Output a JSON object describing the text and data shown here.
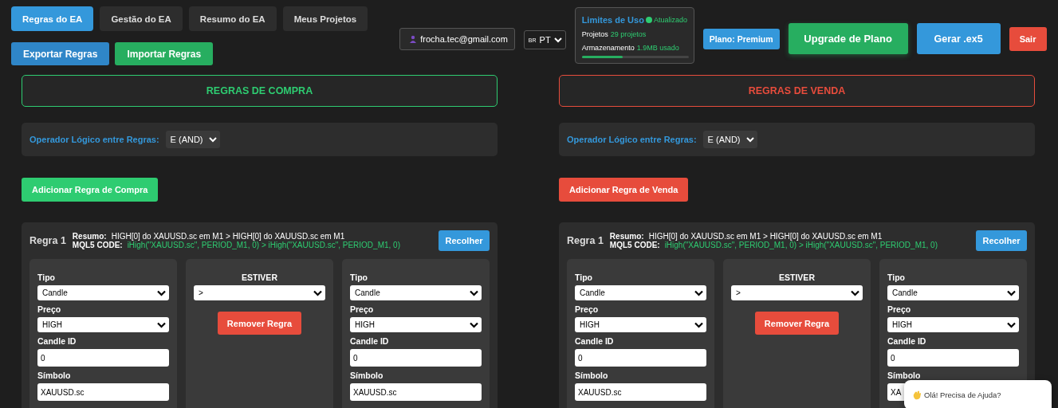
{
  "tabs": [
    {
      "label": "Regras do EA",
      "selected": true
    },
    {
      "label": "Gestão do EA",
      "selected": false
    },
    {
      "label": "Resumo do EA",
      "selected": false
    },
    {
      "label": "Meus Projetos",
      "selected": false
    }
  ],
  "actions": [
    {
      "label": "Exportar Regras",
      "kind": "blue"
    },
    {
      "label": "Importar Regras",
      "kind": "green"
    }
  ],
  "user_email": "frocha.tec@gmail.com",
  "language": {
    "flag": "BR",
    "value": "PT"
  },
  "usage": {
    "title": "Limites de Uso",
    "status": "Atualizado",
    "items": [
      {
        "label": "Projetos",
        "value": "29 projetos"
      },
      {
        "label": "Armazenamento",
        "value": "1.9MB usado"
      }
    ],
    "level": 0.38
  },
  "buttons": [
    {
      "label": "Plano: Premium",
      "kind": "plan"
    },
    {
      "label": "Upgrade de Plano",
      "kind": "upgrade"
    },
    {
      "label": "Gerar .ex5",
      "kind": "generate"
    },
    {
      "label": "Sair",
      "kind": "exit"
    }
  ],
  "sides": [
    {
      "kind": "buy",
      "title": "REGRAS DE COMPRA",
      "operator_label": "Operador Lógico entre Regras:",
      "operator_value": "E (AND)",
      "add_button": "Adicionar Regra de Compra",
      "rule": {
        "title": "Regra 1",
        "summary_label": "Resumo:",
        "summary": "HIGH[0] do XAUUSD.sc em M1 > HIGH[0] do XAUUSD.sc em M1",
        "code_label": "MQL5 CODE:",
        "code": "iHigh(\"XAUUSD.sc\", PERIOD_M1, 0) > iHigh(\"XAUUSD.sc\", PERIOD_M1, 0)",
        "collapse_button": "Recolher",
        "left": [
          {
            "label": "Tipo",
            "kind": "select",
            "value": "Candle"
          },
          {
            "label": "Preço",
            "kind": "select",
            "value": "HIGH"
          },
          {
            "label": "Candle ID",
            "kind": "input",
            "value": "0"
          },
          {
            "label": "Símbolo",
            "kind": "input",
            "value": "XAUUSD.sc"
          }
        ],
        "middle": {
          "label": "ESTIVER",
          "value": ">",
          "remove_button": "Remover Regra"
        },
        "right": [
          {
            "label": "Tipo",
            "kind": "select",
            "value": "Candle"
          },
          {
            "label": "Preço",
            "kind": "select",
            "value": "HIGH"
          },
          {
            "label": "Candle ID",
            "kind": "input",
            "value": "0"
          },
          {
            "label": "Símbolo",
            "kind": "input",
            "value": "XAUUSD.sc"
          }
        ]
      }
    },
    {
      "kind": "sell",
      "title": "REGRAS DE VENDA",
      "operator_label": "Operador Lógico entre Regras:",
      "operator_value": "E (AND)",
      "add_button": "Adicionar Regra de Venda",
      "rule": {
        "title": "Regra 1",
        "summary_label": "Resumo:",
        "summary": "HIGH[0] do XAUUSD.sc em M1 > HIGH[0] do XAUUSD.sc em M1",
        "code_label": "MQL5 CODE:",
        "code": "iHigh(\"XAUUSD.sc\", PERIOD_M1, 0) > iHigh(\"XAUUSD.sc\", PERIOD_M1, 0)",
        "collapse_button": "Recolher",
        "left": [
          {
            "label": "Tipo",
            "kind": "select",
            "value": "Candle"
          },
          {
            "label": "Preço",
            "kind": "select",
            "value": "HIGH"
          },
          {
            "label": "Candle ID",
            "kind": "input",
            "value": "0"
          },
          {
            "label": "Símbolo",
            "kind": "input",
            "value": "XAUUSD.sc"
          }
        ],
        "middle": {
          "label": "ESTIVER",
          "value": ">",
          "remove_button": "Remover Regra"
        },
        "right": [
          {
            "label": "Tipo",
            "kind": "select",
            "value": "Candle"
          },
          {
            "label": "Preço",
            "kind": "select",
            "value": "HIGH"
          },
          {
            "label": "Candle ID",
            "kind": "input",
            "value": "0"
          },
          {
            "label": "Símbolo",
            "kind": "input",
            "value": "XA"
          }
        ]
      }
    }
  ],
  "chat_bubble": "Olá! Precisa de Ajuda?"
}
